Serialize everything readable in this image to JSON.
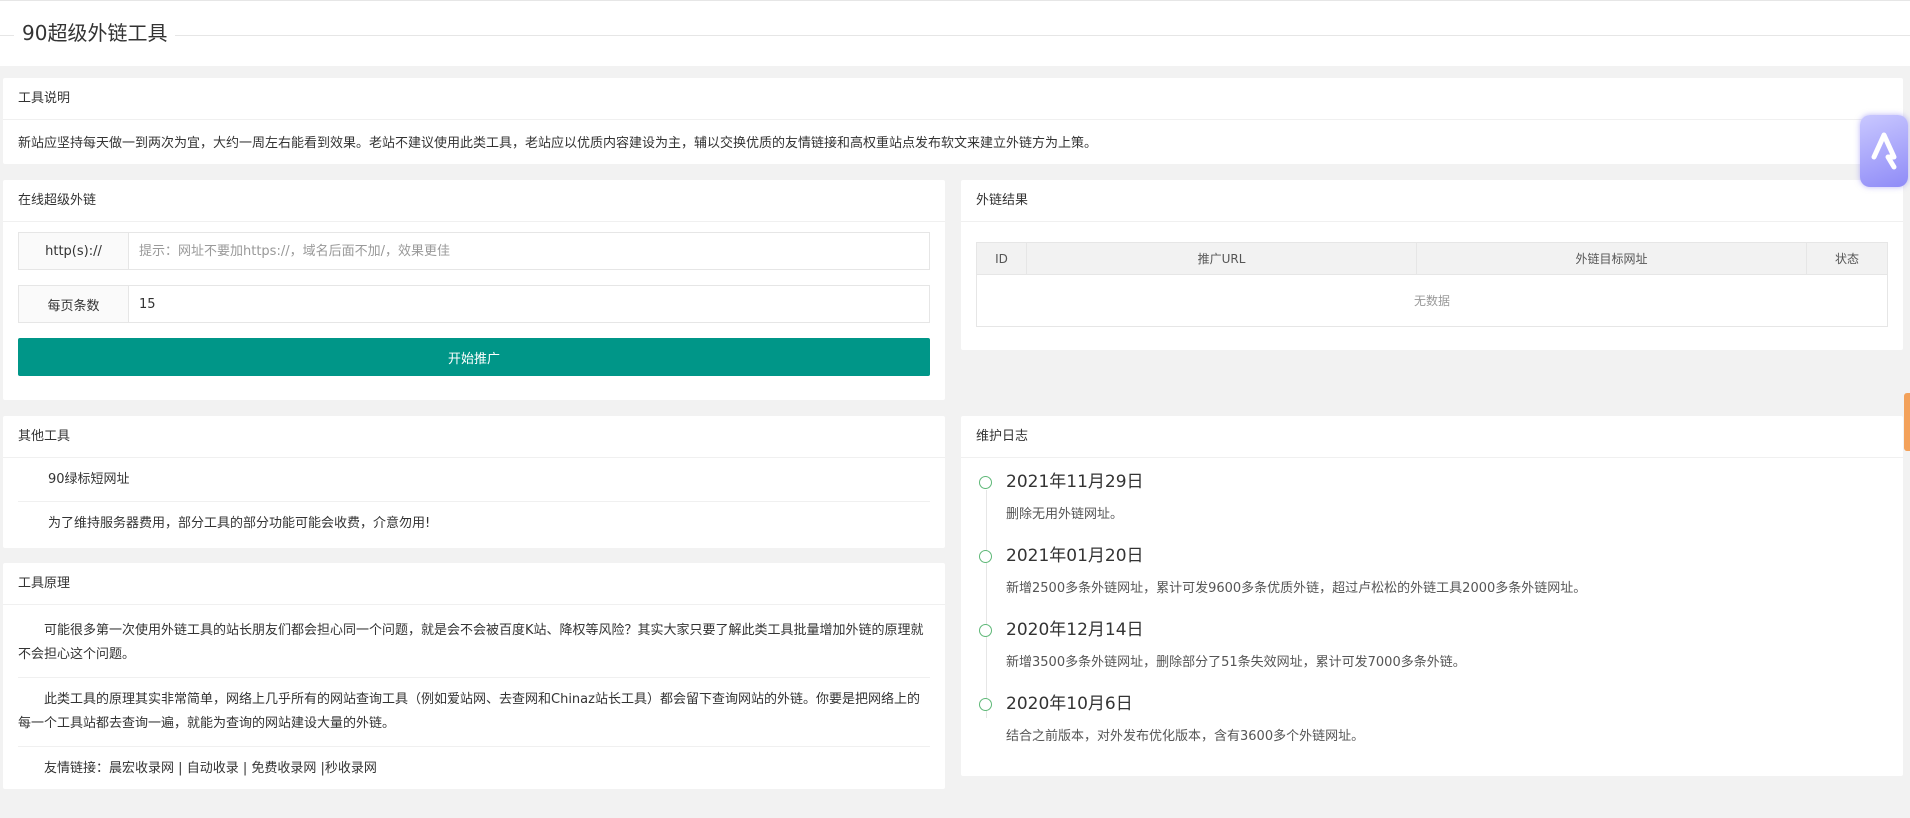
{
  "header": {
    "title": "90超级外链工具"
  },
  "description": {
    "heading": "工具说明",
    "text": "新站应坚持每天做一到两次为宜，大约一周左右能看到效果。老站不建议使用此类工具，老站应以优质内容建设为主，辅以交换优质的友情链接和高权重站点发布软文来建立外链方为上策。"
  },
  "online": {
    "heading": "在线超级外链",
    "url_label": "http(s)://",
    "url_placeholder": "提示：网址不要加https://，域名后面不加/，效果更佳",
    "per_page_label": "每页条数",
    "per_page_value": "15",
    "submit_label": "开始推广"
  },
  "results": {
    "heading": "外链结果",
    "columns": [
      "ID",
      "推广URL",
      "外链目标网址",
      "状态"
    ],
    "empty_text": "无数据"
  },
  "other_tools": {
    "heading": "其他工具",
    "items": [
      "90绿标短网址",
      "为了维持服务器费用，部分工具的部分功能可能会收费，介意勿用!"
    ]
  },
  "principle": {
    "heading": "工具原理",
    "paragraphs": [
      "可能很多第一次使用外链工具的站长朋友们都会担心同一个问题，就是会不会被百度K站、降权等风险？其实大家只要了解此类工具批量增加外链的原理就不会担心这个问题。",
      "此类工具的原理其实非常简单，网络上几乎所有的网站查询工具（例如爱站网、去查网和Chinaz站长工具）都会留下查询网站的外链。你要是把网络上的每一个工具站都去查询一遍，就能为查询的网站建设大量的外链。"
    ],
    "friend_label": "友情链接：",
    "links": [
      "晨宏收录网",
      "自动收录",
      "免费收录网",
      "秒收录网"
    ],
    "separators": [
      " | ",
      " | ",
      " |"
    ]
  },
  "changelog": {
    "heading": "维护日志",
    "entries": [
      {
        "date": "2021年11月29日",
        "desc": "删除无用外链网址。"
      },
      {
        "date": "2021年01月20日",
        "desc": "新增2500多条外链网址，累计可发9600多条优质外链，超过卢松松的外链工具2000多条外链网址。"
      },
      {
        "date": "2020年12月14日",
        "desc": "新增3500多条外链网址，删除部分了51条失效网址，累计可发7000多条外链。"
      },
      {
        "date": "2020年10月6日",
        "desc": "结合之前版本，对外发布优化版本，含有3600多个外链网址。"
      }
    ]
  },
  "colors": {
    "primary": "#009688",
    "timeline_dot": "#5fb878"
  }
}
